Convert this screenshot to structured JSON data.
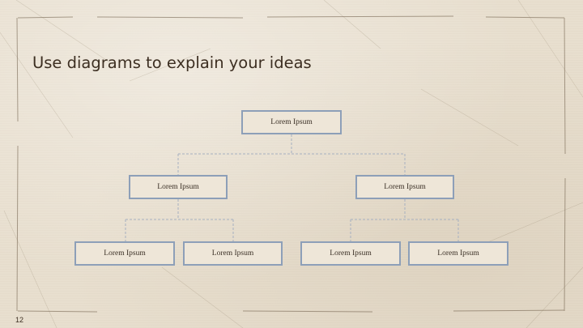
{
  "slide": {
    "title": "Use diagrams to explain your ideas",
    "page_number": "12"
  },
  "diagram": {
    "nodes": [
      {
        "id": "root",
        "label": "Lorem Ipsum",
        "level": 0,
        "parent": null
      },
      {
        "id": "left-branch",
        "label": "Lorem Ipsum",
        "level": 1,
        "parent": "root"
      },
      {
        "id": "right-branch",
        "label": "Lorem Ipsum",
        "level": 1,
        "parent": "root"
      },
      {
        "id": "left-leaf-1",
        "label": "Lorem Ipsum",
        "level": 2,
        "parent": "left-branch"
      },
      {
        "id": "left-leaf-2",
        "label": "Lorem Ipsum",
        "level": 2,
        "parent": "left-branch"
      },
      {
        "id": "right-leaf-1",
        "label": "Lorem Ipsum",
        "level": 2,
        "parent": "right-branch"
      },
      {
        "id": "right-leaf-2",
        "label": "Lorem Ipsum",
        "level": 2,
        "parent": "right-branch"
      }
    ]
  },
  "colors": {
    "background": "#e8dfcf",
    "node_border": "#8d9fb8",
    "connector": "#a6b0c0",
    "title_text": "#3d2f22"
  }
}
